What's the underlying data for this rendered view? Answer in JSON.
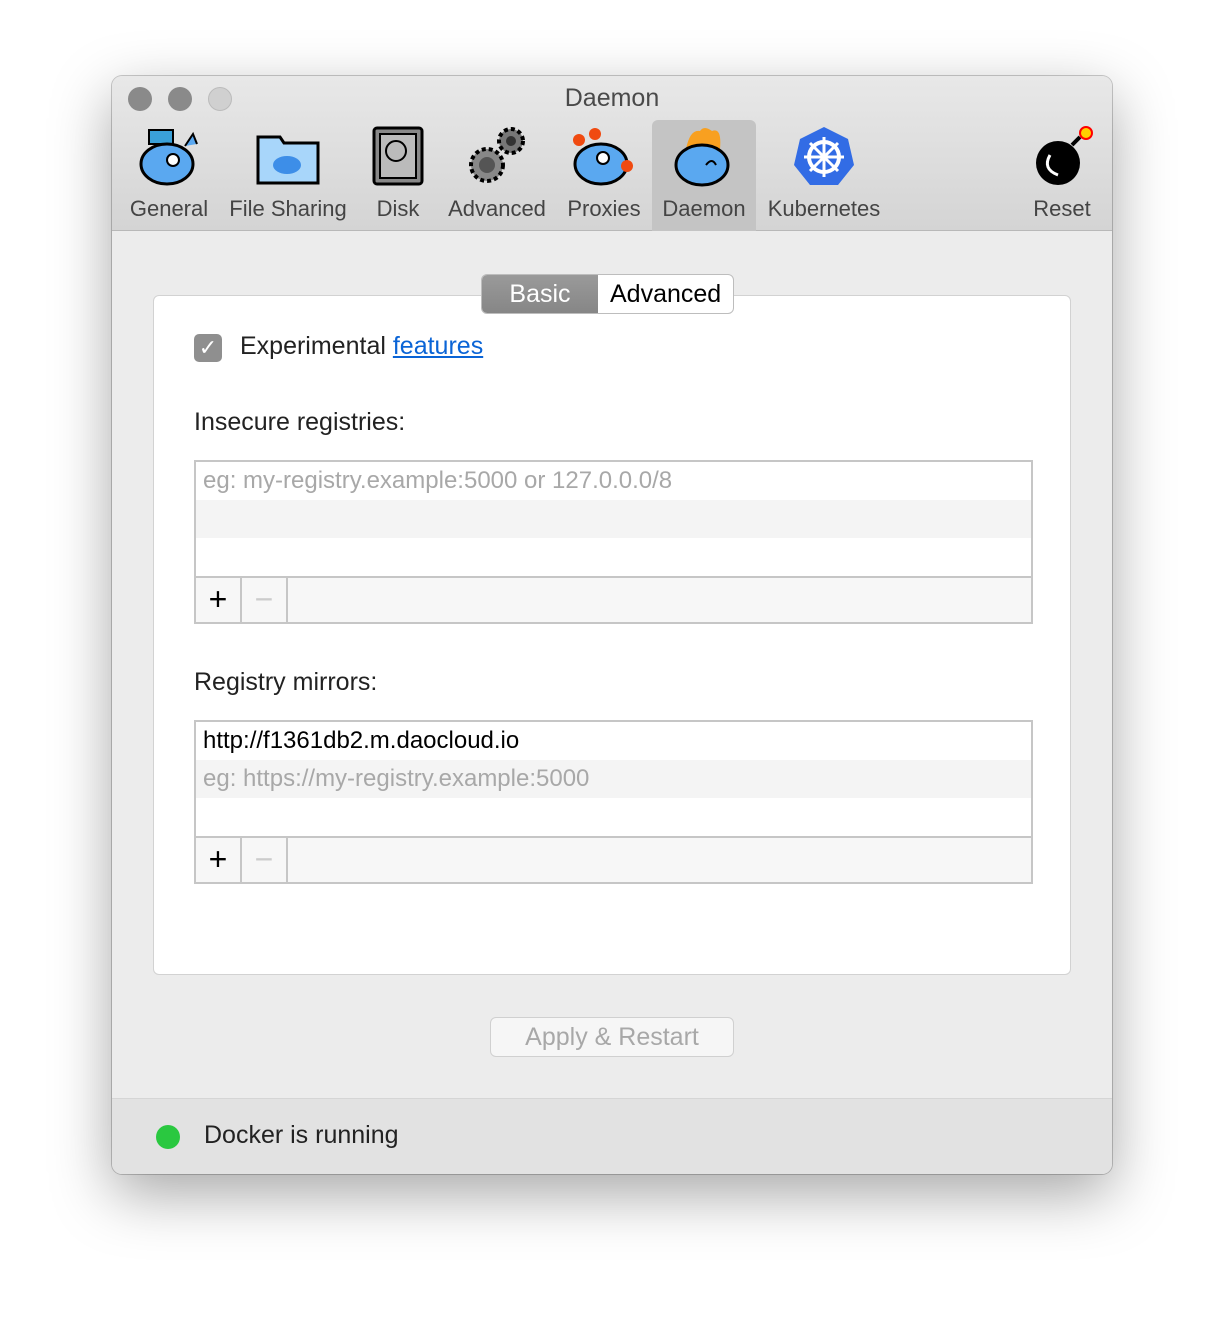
{
  "window": {
    "title": "Daemon"
  },
  "toolbar": {
    "items": [
      {
        "label": "General",
        "icon": "docker-whale-icon"
      },
      {
        "label": "File Sharing",
        "icon": "folder-icon"
      },
      {
        "label": "Disk",
        "icon": "disk-icon"
      },
      {
        "label": "Advanced",
        "icon": "gears-icon"
      },
      {
        "label": "Proxies",
        "icon": "proxy-whale-icon"
      },
      {
        "label": "Daemon",
        "icon": "daemon-whale-icon",
        "selected": true
      },
      {
        "label": "Kubernetes",
        "icon": "kubernetes-icon"
      },
      {
        "label": "Reset",
        "icon": "bomb-icon"
      }
    ]
  },
  "segmented": {
    "basic": "Basic",
    "advanced": "Advanced",
    "selected": "Basic"
  },
  "experimental": {
    "checked": true,
    "label": "Experimental",
    "link": "features"
  },
  "insecure": {
    "label": "Insecure registries:",
    "placeholder": "eg: my-registry.example:5000 or 127.0.0.0/8",
    "items": []
  },
  "mirrors": {
    "label": "Registry mirrors:",
    "items": [
      "http://f1361db2.m.daocloud.io"
    ],
    "placeholder": "eg: https://my-registry.example:5000"
  },
  "buttons": {
    "add": "+",
    "remove": "−",
    "apply": "Apply & Restart"
  },
  "status": {
    "text": "Docker is running",
    "color": "#2ac840"
  }
}
